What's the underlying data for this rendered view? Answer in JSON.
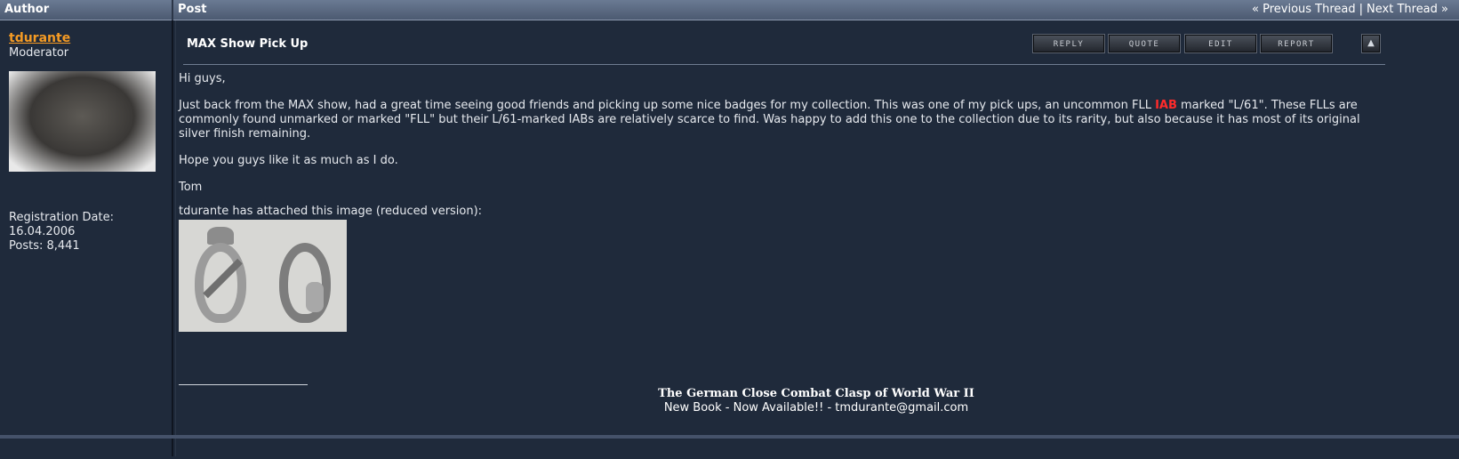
{
  "header": {
    "author_label": "Author",
    "post_label": "Post",
    "prev_thread": "« Previous Thread",
    "separator": "|",
    "next_thread": "Next Thread »"
  },
  "author": {
    "username": "tdurante",
    "title": "Moderator",
    "registration_label": "Registration Date:",
    "registration_date": "16.04.2006",
    "posts": "Posts: 8,441"
  },
  "post": {
    "title": "MAX Show Pick Up",
    "buttons": {
      "reply": "REPLY",
      "quote": "QUOTE",
      "edit": "EDIT",
      "report": "REPORT"
    },
    "greeting": "Hi guys,",
    "para1_a": "Just back from the MAX show, had a great time seeing good friends and picking up some nice badges for my collection. This was one of my pick ups, an uncommon FLL ",
    "para1_highlight": "IAB",
    "para1_b": " marked \"L/61\". These FLLs are commonly found unmarked or marked \"FLL\" but their L/61-marked IABs are relatively scarce to find. Was happy to add this one to the collection due to its rarity, but also because it has most of its original silver finish remaining.",
    "para2": "Hope you guys like it as much as I do.",
    "signoff": "Tom",
    "attachment_label": "tdurante has attached this image (reduced version):",
    "signature_title": "The German Close Combat Clasp of World War II",
    "signature_sub": "New Book - Now Available!! - tmdurante@gmail.com"
  },
  "colors": {
    "background": "#1f2a3b",
    "username": "#f59b24",
    "highlight": "#ff2b2b"
  }
}
